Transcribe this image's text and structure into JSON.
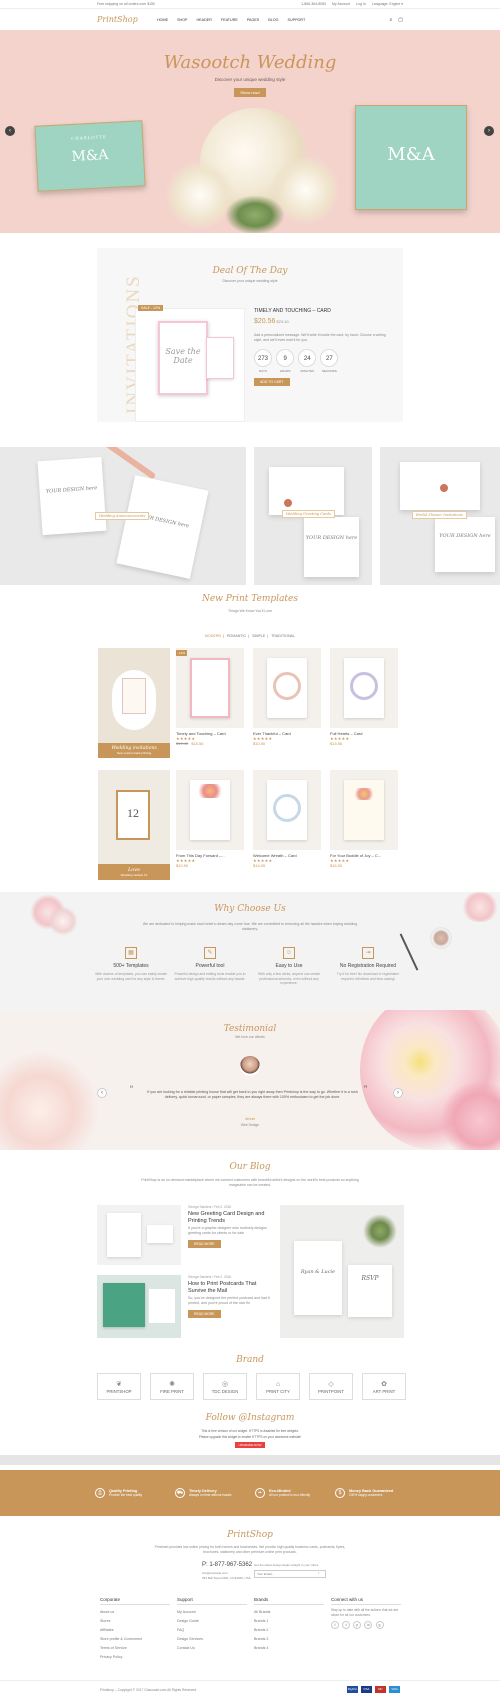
{
  "topbar": {
    "shipping": "Free shipping on all orders over $150",
    "phone": "1-866-364-8083",
    "account": "My Account",
    "login": "Log In",
    "language": "Language: Engine ▾"
  },
  "nav": {
    "logo": "PrintShop",
    "items": [
      "HOME",
      "SHOP",
      "HEADER",
      "FEATURE",
      "PAGES",
      "BLOG",
      "SUPPORT"
    ]
  },
  "hero": {
    "title": "Wasootch Wedding",
    "subtitle": "Discover your unique wedding style",
    "button": "Show now!",
    "card_left_top": "CHARLOTTE",
    "card_monogram": "M&A"
  },
  "deal": {
    "title": "Deal Of The Day",
    "subtitle": "Discover your unique wedding style",
    "side_text": "INVITATIONS",
    "badge": "SALE - 12%",
    "product_name": "TIMELY AND TOUCHING – CARD",
    "price": "$20.56",
    "old_price": "$23.40",
    "description": "Add a personalized message. We'll write it inside the card, by hand. Choose a writing style, and we'll even mail it for you.",
    "countdown": [
      {
        "value": "273",
        "label": "DAYS"
      },
      {
        "value": "9",
        "label": "HOURS"
      },
      {
        "value": "24",
        "label": "MINUTES"
      },
      {
        "value": "27",
        "label": "SECONDS"
      }
    ],
    "button": "ADD TO CART",
    "card_text": "Save the Date"
  },
  "banners": {
    "b1": "Wedding Announcements",
    "b2": "Wedding Greeting Cards",
    "b3": "Bridal Shower Invitations",
    "design_text": "YOUR DESIGN here"
  },
  "templates": {
    "title": "New Print Templates",
    "subtitle": "Things We Know You'll Love",
    "tabs": [
      "MODERN",
      "ROMANTIC",
      "SIMPLE",
      "TRADITIONAL"
    ],
    "promo1_title": "Wedding invitations",
    "promo1_sub": "New custom back printing",
    "promo2_title": "Love",
    "promo2_sub": "Wedding cardset 12",
    "promo2_number": "12",
    "products": [
      {
        "name": "Timely and Touching – Card",
        "stars": "★★★★★",
        "old": "$19.40",
        "price": "$15.56",
        "badge": "-12%"
      },
      {
        "name": "Ever Thankful – Card",
        "stars": "★★★★★",
        "old": "",
        "price": "$10.50",
        "badge": ""
      },
      {
        "name": "Full Hearts – Card",
        "stars": "★★★★★",
        "old": "",
        "price": "$15.56",
        "badge": ""
      },
      {
        "name": "From This Day Forward –...",
        "stars": "★★★★★",
        "old": "",
        "price": "$10.50",
        "badge": ""
      },
      {
        "name": "Welcome Wreath – Card",
        "stars": "★★★★★",
        "old": "",
        "price": "$14.95",
        "badge": ""
      },
      {
        "name": "For Your Buddle of Joy – C...",
        "stars": "★★★★★",
        "old": "",
        "price": "$16.50",
        "badge": ""
      }
    ]
  },
  "why": {
    "title": "Why Choose Us",
    "intro": "We are dedicated to helping make each bride's dream day come true. We are committed to removing all the hassles when buying wedding stationery.",
    "features": [
      {
        "icon": "▦",
        "title": "500+ Templates",
        "desc": "With dozens of templates, you can easily create your own wedding card for any style & theme."
      },
      {
        "icon": "✎",
        "title": "Powerful tool",
        "desc": "Powerful design and editing tools enable you to achieve high-quality results without any hassle."
      },
      {
        "icon": "☺",
        "title": "Easy to Use",
        "desc": "With only a few clicks, anyone can create professional artworks, even without any experience."
      },
      {
        "icon": "⇥",
        "title": "No Registration Required",
        "desc": "Try it for free! No download or registration required: effortless and time-saving!"
      }
    ]
  },
  "testimonial": {
    "title": "Testimonial",
    "subtitle": "We love our clients",
    "quote": "If you are looking for a reliable printing house that will get back to you right away then Printshop is the way to go. Whether it is a rush delivery, quick turnaround, or paper samples, they are always there with 100% enthusiasm to get the job done.",
    "name": "Jennie",
    "role": "Web Design"
  },
  "blog": {
    "title": "Our Blog",
    "intro": "PrintShop is an on-demand marketplace where we connect customers with beautiful artist's designs on the world's best products so anything imaginable can be created.",
    "posts": [
      {
        "meta": "George Sanders / Feb 2, 2018",
        "title": "New Greeting Card Design and Printing Trends",
        "desc": "If you're a graphic designer who routinely designs greeting cards for clients or for sale",
        "button": "READ MORE"
      },
      {
        "meta": "George Sanders / Feb 2, 2018",
        "title": "How to Print Postcards That Survive the Mail",
        "desc": "So, you've designed the perfect postcard and had it printed, and you're proud of the nice fin",
        "button": "READ MORE"
      }
    ],
    "card_names": "Ryan & Lucie",
    "rsvp": "RSVP"
  },
  "brand": {
    "title": "Brand",
    "items": [
      "PRINTSHOP",
      "FIRE PRINT",
      "TDC DESIGN",
      "PRINT CITY",
      "PRINTPOINT",
      "ART PRINT"
    ]
  },
  "instagram": {
    "title": "Follow @Instagram",
    "line1": "This is free version of our widget. HTTPS is disabled for free widgets.",
    "line2": "Please upgrade this widget to enable HTTPS on your awesome website!",
    "button": "UPGRADE NOW"
  },
  "services": [
    {
      "title": "Quality Printing",
      "desc": "Provide the best quality"
    },
    {
      "title": "Timely Delivery",
      "desc": "Always on time without hassle"
    },
    {
      "title": "Eco-Minded",
      "desc": "All our product is eco-friendly"
    },
    {
      "title": "Money Back Guaranteed",
      "desc": "100% happy customers"
    }
  ],
  "footer": {
    "logo": "PrintShop",
    "about": "Printmart provides low online pricing for both homes and businesses. We provide high quality business cards, postcards, flyers, brochures, stationery and other premium online print products.",
    "phone": "P: 1-877-967-5362",
    "email": "info@example.com",
    "address": "363 Bell Street Mall, CA 94040, USA",
    "newsletter_label": "Get the latest design deals straight to your inbox",
    "newsletter_placeholder": "Your Email...",
    "columns": [
      {
        "title": "Corporate",
        "items": [
          "About us",
          "Stores",
          "Affiliates",
          "Store profile & Covenment",
          "Terms of Service",
          "Privacy Policy"
        ]
      },
      {
        "title": "Support",
        "items": [
          "My Account",
          "Design Guide",
          "FAQ",
          "Design Services",
          "Contact Us"
        ]
      },
      {
        "title": "Brands",
        "items": [
          "All Brands",
          "Brands 1",
          "Brands 2",
          "Brands 3",
          "Brands 4"
        ]
      },
      {
        "title": "Connect with us",
        "items": [
          "Stay up to date with all the actions that we are about for all our customers."
        ]
      }
    ],
    "social": [
      "f",
      "t",
      "p",
      "in",
      "g"
    ],
    "copyright": "Printshop – Copyright © 2017 Chasocart.com All Rights Reserved.",
    "payments": [
      "PayPal",
      "VISA",
      "MC",
      "VISA"
    ]
  },
  "colors": {
    "accent": "#c9965a",
    "hero_bg": "#f4d3cd",
    "mint": "#9fd3c2"
  }
}
